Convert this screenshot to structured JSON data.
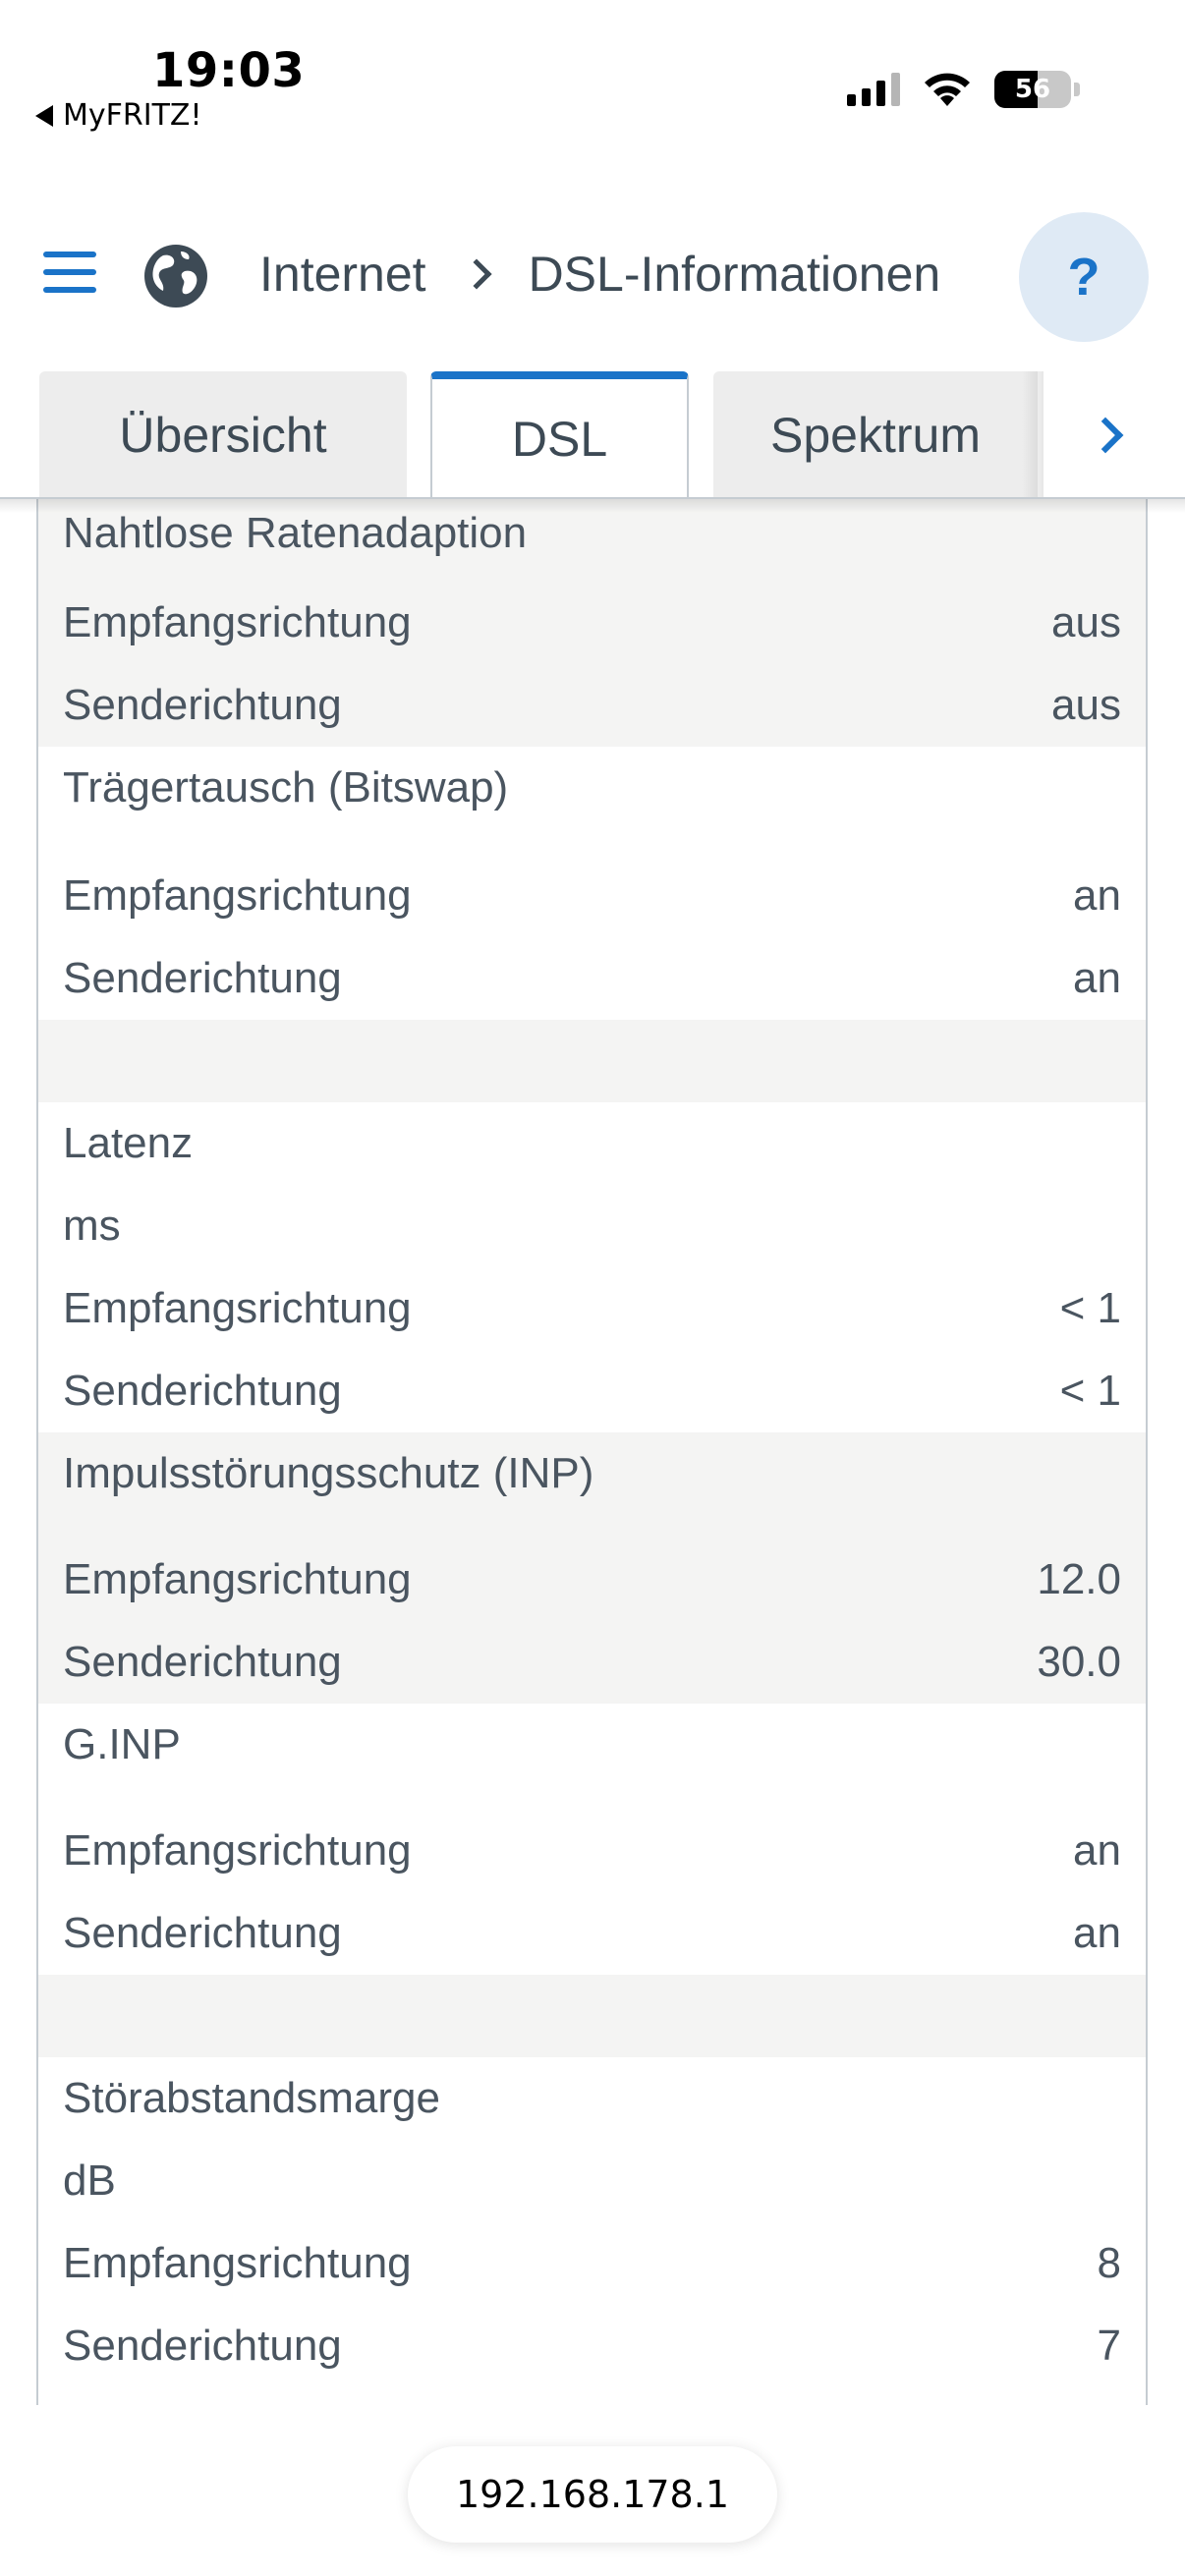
{
  "status_bar": {
    "time": "19:03",
    "back_app": "MyFRITZ!",
    "battery": "56"
  },
  "header": {
    "breadcrumb": [
      "Internet",
      "DSL-Informationen"
    ],
    "help_label": "?"
  },
  "tabs": [
    {
      "label": "Übersicht",
      "active": false
    },
    {
      "label": "DSL",
      "active": true
    },
    {
      "label": "Spektrum",
      "active": false
    }
  ],
  "content": {
    "nahtlos": {
      "title": "Nahtlose Ratenadaption",
      "rx_label": "Empfangsrichtung",
      "rx": "aus",
      "tx_label": "Senderichtung",
      "tx": "aus"
    },
    "bitswap": {
      "title": "Trägertausch (Bitswap)",
      "rx_label": "Empfangsrichtung",
      "rx": "an",
      "tx_label": "Senderichtung",
      "tx": "an"
    },
    "latenz": {
      "title": "Latenz",
      "unit": "ms",
      "rx_label": "Empfangsrichtung",
      "rx": "< 1",
      "tx_label": "Senderichtung",
      "tx": "< 1"
    },
    "inp": {
      "title": "Impulsstörungsschutz (INP)",
      "rx_label": "Empfangsrichtung",
      "rx": "12.0",
      "tx_label": "Senderichtung",
      "tx": "30.0"
    },
    "ginp": {
      "title": "G.INP",
      "rx_label": "Empfangsrichtung",
      "rx": "an",
      "tx_label": "Senderichtung",
      "tx": "an"
    },
    "snr": {
      "title": "Störabstandsmarge",
      "unit": "dB",
      "rx_label": "Empfangsrichtung",
      "rx": "8",
      "tx_label": "Senderichtung",
      "tx": "7"
    }
  },
  "url_bar": {
    "address": "192.168.178.1"
  },
  "colors": {
    "accent": "#1a73c8",
    "gray_row": "#f4f4f3",
    "text": "#4a5560"
  }
}
